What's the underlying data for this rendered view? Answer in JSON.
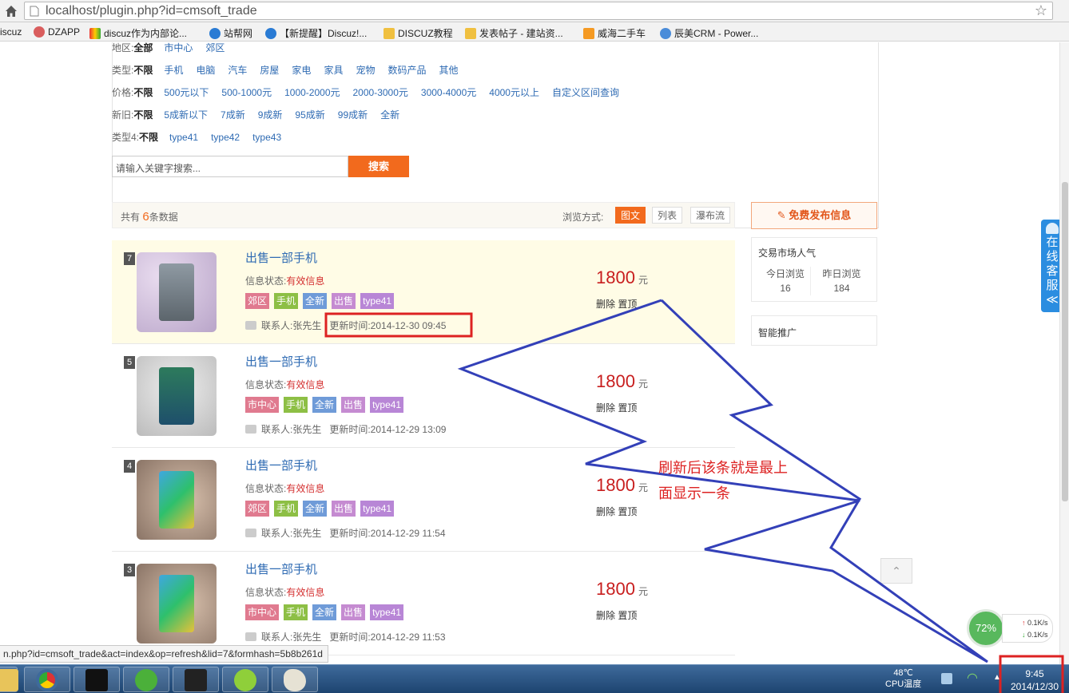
{
  "browser": {
    "url": "localhost/plugin.php?id=cmsoft_trade",
    "bookmarks": [
      "iscuz",
      "DZAPP",
      "discuz作为内部论...",
      "站帮网",
      "【新提醒】Discuz!...",
      "DISCUZ教程",
      "发表帖子 - 建站资...",
      "威海二手车",
      "辰美CRM - Power..."
    ]
  },
  "filters": {
    "region": {
      "label": "地区:",
      "all": "全部",
      "options": [
        "市中心",
        "郊区"
      ]
    },
    "type": {
      "label": "类型:",
      "all": "不限",
      "options": [
        "手机",
        "电脑",
        "汽车",
        "房屋",
        "家电",
        "家具",
        "宠物",
        "数码产品",
        "其他"
      ]
    },
    "price": {
      "label": "价格:",
      "all": "不限",
      "options": [
        "500元以下",
        "500-1000元",
        "1000-2000元",
        "2000-3000元",
        "3000-4000元",
        "4000元以上",
        "自定义区间查询"
      ]
    },
    "condition": {
      "label": "新旧:",
      "all": "不限",
      "options": [
        "5成新以下",
        "7成新",
        "9成新",
        "95成新",
        "99成新",
        "全新"
      ]
    },
    "type4": {
      "label": "类型4:",
      "all": "不限",
      "options": [
        "type41",
        "type42",
        "type43"
      ]
    }
  },
  "search": {
    "placeholder": "请输入关键字搜索...",
    "button": "搜索"
  },
  "list_header": {
    "prefix": "共有",
    "count": "6",
    "suffix": "条数据",
    "view_label": "浏览方式:",
    "views": [
      "图文",
      "列表",
      "瀑布流"
    ]
  },
  "listings": [
    {
      "num": "7",
      "title": "出售一部手机",
      "status_label": "信息状态:",
      "status": "有效信息",
      "tags": [
        "郊区",
        "手机",
        "全新",
        "出售",
        "type41"
      ],
      "contact": "联系人:张先生",
      "updated": "更新时间:2014-12-30 09:45",
      "price": "1800",
      "unit": "元",
      "ops": "删除 置顶"
    },
    {
      "num": "5",
      "title": "出售一部手机",
      "status_label": "信息状态:",
      "status": "有效信息",
      "tags": [
        "市中心",
        "手机",
        "全新",
        "出售",
        "type41"
      ],
      "contact": "联系人:张先生",
      "updated": "更新时间:2014-12-29 13:09",
      "price": "1800",
      "unit": "元",
      "ops": "删除 置顶"
    },
    {
      "num": "4",
      "title": "出售一部手机",
      "status_label": "信息状态:",
      "status": "有效信息",
      "tags": [
        "郊区",
        "手机",
        "全新",
        "出售",
        "type41"
      ],
      "contact": "联系人:张先生",
      "updated": "更新时间:2014-12-29 11:54",
      "price": "1800",
      "unit": "元",
      "ops": "删除 置顶"
    },
    {
      "num": "3",
      "title": "出售一部手机",
      "status_label": "信息状态:",
      "status": "有效信息",
      "tags": [
        "市中心",
        "手机",
        "全新",
        "出售",
        "type41"
      ],
      "contact": "联系人:张先生",
      "updated": "更新时间:2014-12-29 11:53",
      "price": "1800",
      "unit": "元",
      "ops": "删除 置顶"
    }
  ],
  "tag_colors": {
    "郊区": "#e07a8f",
    "市中心": "#e07a8f",
    "手机": "#8dbf45",
    "全新": "#6f9bd8",
    "出售": "#c58bd1",
    "type41": "#b886d6"
  },
  "sidebar": {
    "publish": "免费发布信息",
    "popularity": {
      "title": "交易市场人气",
      "today_label": "今日浏览",
      "today": "16",
      "yesterday_label": "昨日浏览",
      "yesterday": "184"
    },
    "promo": "智能推广"
  },
  "widgets": {
    "kefu": "在线客服",
    "kefu_arrow": "≪",
    "cpu_percent": "72%",
    "up_speed": "0.1K/s",
    "down_speed": "0.1K/s"
  },
  "annotation": {
    "line1": "刷新后该条就是最上",
    "line2": "面显示一条"
  },
  "status_url": "n.php?id=cmsoft_trade&act=index&op=refresh&lid=7&formhash=5b8b261d",
  "taskbar": {
    "temp": "48℃",
    "temp_label": "CPU温度",
    "time": "9:45",
    "date": "2014/12/30"
  },
  "colors": {
    "accent": "#f26a1d",
    "link": "#2f6bb3",
    "price": "#c81e1e",
    "annotation_red": "#dd2222",
    "annotation_blue": "#3340b8"
  }
}
